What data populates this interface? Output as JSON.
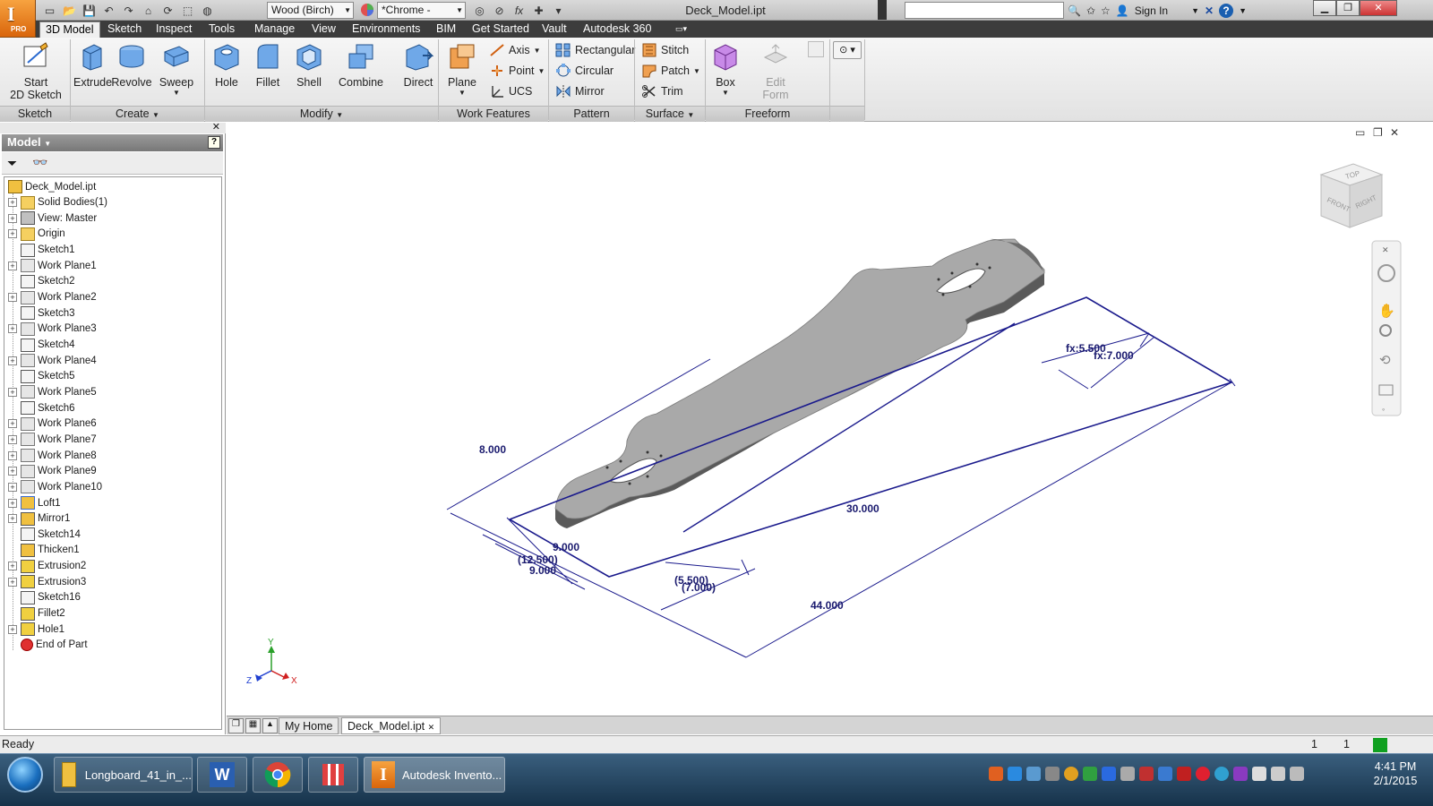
{
  "app": {
    "pro_label": "PRO"
  },
  "quick_access": {
    "material": "Wood (Birch)",
    "appearance": "*Chrome -",
    "fx": "fx"
  },
  "title": "Deck_Model.ipt",
  "help": {
    "search_placeholder": "",
    "sign_in": "Sign In",
    "help_icon": "?"
  },
  "ribbon_tabs": [
    "3D Model",
    "Sketch",
    "Inspect",
    "Tools",
    "Manage",
    "View",
    "Environments",
    "BIM",
    "Get Started",
    "Vault",
    "Autodesk 360"
  ],
  "ribbon": {
    "sketch": {
      "start_line1": "Start",
      "start_line2": "2D Sketch",
      "panel": "Sketch"
    },
    "create": {
      "extrude": "Extrude",
      "revolve": "Revolve",
      "sweep": "Sweep",
      "panel": "Create"
    },
    "modify": {
      "hole": "Hole",
      "fillet": "Fillet",
      "shell": "Shell",
      "combine": "Combine",
      "direct": "Direct",
      "panel": "Modify"
    },
    "work_features": {
      "plane": "Plane",
      "axis": "Axis",
      "point": "Point",
      "ucs": "UCS",
      "panel": "Work Features"
    },
    "pattern": {
      "rectangular": "Rectangular",
      "circular": "Circular",
      "mirror": "Mirror",
      "panel": "Pattern"
    },
    "surface": {
      "stitch": "Stitch",
      "patch": "Patch",
      "trim": "Trim",
      "panel": "Surface"
    },
    "freeform": {
      "box": "Box",
      "edit_line1": "Edit",
      "edit_line2": "Form",
      "panel": "Freeform"
    }
  },
  "browser": {
    "title": "Model",
    "help": "?",
    "tree": [
      {
        "label": "Deck_Model.ipt",
        "icon": "part-icon",
        "exp": false,
        "root": true
      },
      {
        "label": "Solid Bodies(1)",
        "icon": "folder-icon",
        "exp": true
      },
      {
        "label": "View: Master",
        "icon": "view-icon",
        "exp": true
      },
      {
        "label": "Origin",
        "icon": "folder-icon",
        "exp": true
      },
      {
        "label": "Sketch1",
        "icon": "sketch-icon",
        "exp": false
      },
      {
        "label": "Work Plane1",
        "icon": "workplane-icon",
        "exp": true
      },
      {
        "label": "Sketch2",
        "icon": "sketch-icon",
        "exp": false
      },
      {
        "label": "Work Plane2",
        "icon": "workplane-icon",
        "exp": true
      },
      {
        "label": "Sketch3",
        "icon": "sketch-icon",
        "exp": false
      },
      {
        "label": "Work Plane3",
        "icon": "workplane-icon",
        "exp": true
      },
      {
        "label": "Sketch4",
        "icon": "sketch-icon",
        "exp": false
      },
      {
        "label": "Work Plane4",
        "icon": "workplane-icon",
        "exp": true
      },
      {
        "label": "Sketch5",
        "icon": "sketch-icon",
        "exp": false
      },
      {
        "label": "Work Plane5",
        "icon": "workplane-icon",
        "exp": true
      },
      {
        "label": "Sketch6",
        "icon": "sketch-icon",
        "exp": false
      },
      {
        "label": "Work Plane6",
        "icon": "workplane-icon",
        "exp": true
      },
      {
        "label": "Work Plane7",
        "icon": "workplane-icon",
        "exp": true
      },
      {
        "label": "Work Plane8",
        "icon": "workplane-icon",
        "exp": true
      },
      {
        "label": "Work Plane9",
        "icon": "workplane-icon",
        "exp": true
      },
      {
        "label": "Work Plane10",
        "icon": "workplane-icon",
        "exp": true
      },
      {
        "label": "Loft1",
        "icon": "loft-icon",
        "exp": true
      },
      {
        "label": "Mirror1",
        "icon": "mirror-icon",
        "exp": true
      },
      {
        "label": "Sketch14",
        "icon": "sketch-icon",
        "exp": false
      },
      {
        "label": "Thicken1",
        "icon": "thicken-icon",
        "exp": false
      },
      {
        "label": "Extrusion2",
        "icon": "extrusion-icon",
        "exp": true
      },
      {
        "label": "Extrusion3",
        "icon": "extrusion-icon",
        "exp": true
      },
      {
        "label": "Sketch16",
        "icon": "sketch-icon",
        "exp": false
      },
      {
        "label": "Fillet2",
        "icon": "fillet-icon",
        "exp": false
      },
      {
        "label": "Hole1",
        "icon": "hole-icon",
        "exp": true
      },
      {
        "label": "End of Part",
        "icon": "end-of-part-icon",
        "exp": false
      }
    ]
  },
  "viewport": {
    "viewcube": {
      "top": "TOP",
      "front": "FRONT",
      "right": "RIGHT"
    },
    "dimensions": {
      "width_8": "8.000",
      "fx_5500": "fx:5.500",
      "fx_7000": "fx:7.000",
      "len_30": "30.000",
      "len_44": "44.000",
      "d_9a": "9.000",
      "d_12500": "(12.500)",
      "d_9b": "9.000",
      "d_5500": "(5.500)",
      "d_7000": "(7.000)"
    },
    "axes": {
      "x": "X",
      "y": "Y",
      "z": "Z"
    }
  },
  "doc_tabs": [
    "My Home",
    "Deck_Model.ipt"
  ],
  "status": {
    "text": "Ready",
    "count1": "1",
    "count2": "1"
  },
  "taskbar": {
    "items": [
      "Longboard_41_in_...",
      "Autodesk Invento..."
    ],
    "time": "4:41 PM",
    "date": "2/1/2015"
  },
  "colors": {
    "accent_orange": "#e7801f",
    "dimension_blue": "#1a1a8c",
    "deck_gray": "#a9a9a9"
  }
}
